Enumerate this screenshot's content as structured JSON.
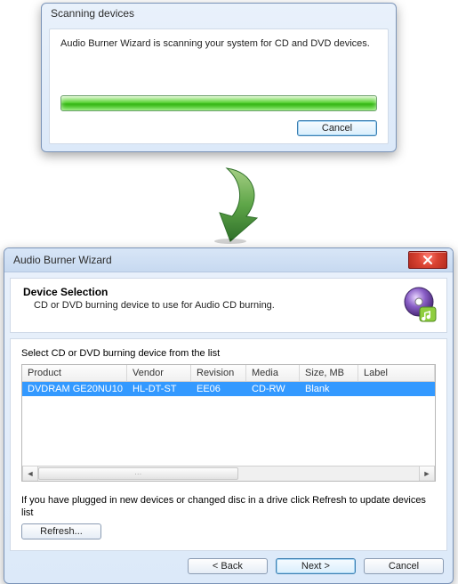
{
  "scan_dialog": {
    "title": "Scanning devices",
    "message": "Audio Burner Wizard is scanning your system for CD and DVD devices.",
    "cancel_label": "Cancel"
  },
  "wizard": {
    "title": "Audio Burner Wizard",
    "header_title": "Device Selection",
    "header_sub": "CD or DVD burning device to use for Audio CD burning.",
    "select_label": "Select CD or DVD burning device from the list",
    "columns": {
      "product": "Product",
      "vendor": "Vendor",
      "revision": "Revision",
      "media": "Media",
      "size": "Size, MB",
      "label": "Label"
    },
    "rows": [
      {
        "product": "DVDRAM GE20NU10",
        "vendor": "HL-DT-ST",
        "revision": "EE06",
        "media": "CD-RW",
        "size": "Blank",
        "label": ""
      }
    ],
    "refresh_note": "If you have plugged in new devices or changed disc in a drive click Refresh to update devices list",
    "refresh_label": "Refresh...",
    "back_label": "< Back",
    "next_label": "Next >",
    "cancel_label": "Cancel"
  }
}
